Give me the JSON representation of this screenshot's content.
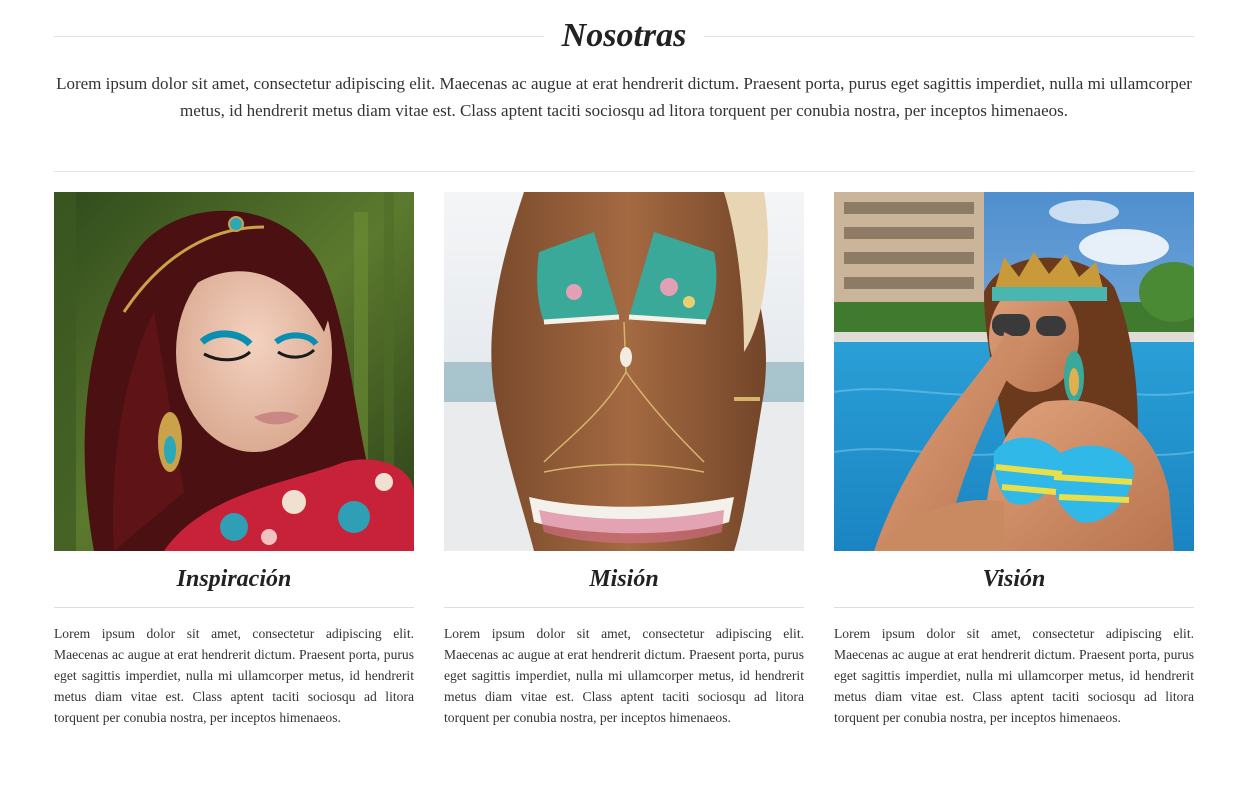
{
  "header": {
    "title": "Nosotras",
    "intro": "Lorem ipsum dolor sit amet, consectetur adipiscing elit. Maecenas ac augue at erat hendrerit dictum. Praesent porta, purus eget sagittis imperdiet, nulla mi ullamcorper metus, id hendrerit metus diam vitae est. Class aptent taciti sociosqu ad litora torquent per conubia nostra, per inceptos himenaeos."
  },
  "columns": [
    {
      "title": "Inspiración",
      "text": "Lorem ipsum dolor sit amet, consectetur adipiscing elit. Maecenas ac augue at erat hendrerit dictum. Praesent porta, purus eget sagittis imperdiet, nulla mi ullamcorper metus, id hendrerit metus diam vitae est. Class aptent taciti sociosqu ad litora torquent per conubia nostra, per inceptos himenaeos."
    },
    {
      "title": "Misión",
      "text": "Lorem ipsum dolor sit amet, consectetur adipiscing elit. Maecenas ac augue at erat hendrerit dictum. Praesent porta, purus eget sagittis imperdiet, nulla mi ullamcorper metus, id hendrerit metus diam vitae est. Class aptent taciti sociosqu ad litora torquent per conubia nostra, per inceptos himenaeos."
    },
    {
      "title": "Visión",
      "text": "Lorem ipsum dolor sit amet, consectetur adipiscing elit. Maecenas ac augue at erat hendrerit dictum. Praesent porta, purus eget sagittis imperdiet, nulla mi ullamcorper metus, id hendrerit metus diam vitae est. Class aptent taciti sociosqu ad litora torquent per conubia nostra, per inceptos himenaeos."
    }
  ],
  "colors": {
    "text": "#333333",
    "heading": "#222222",
    "divider": "#e1e1e1",
    "background": "#ffffff"
  }
}
